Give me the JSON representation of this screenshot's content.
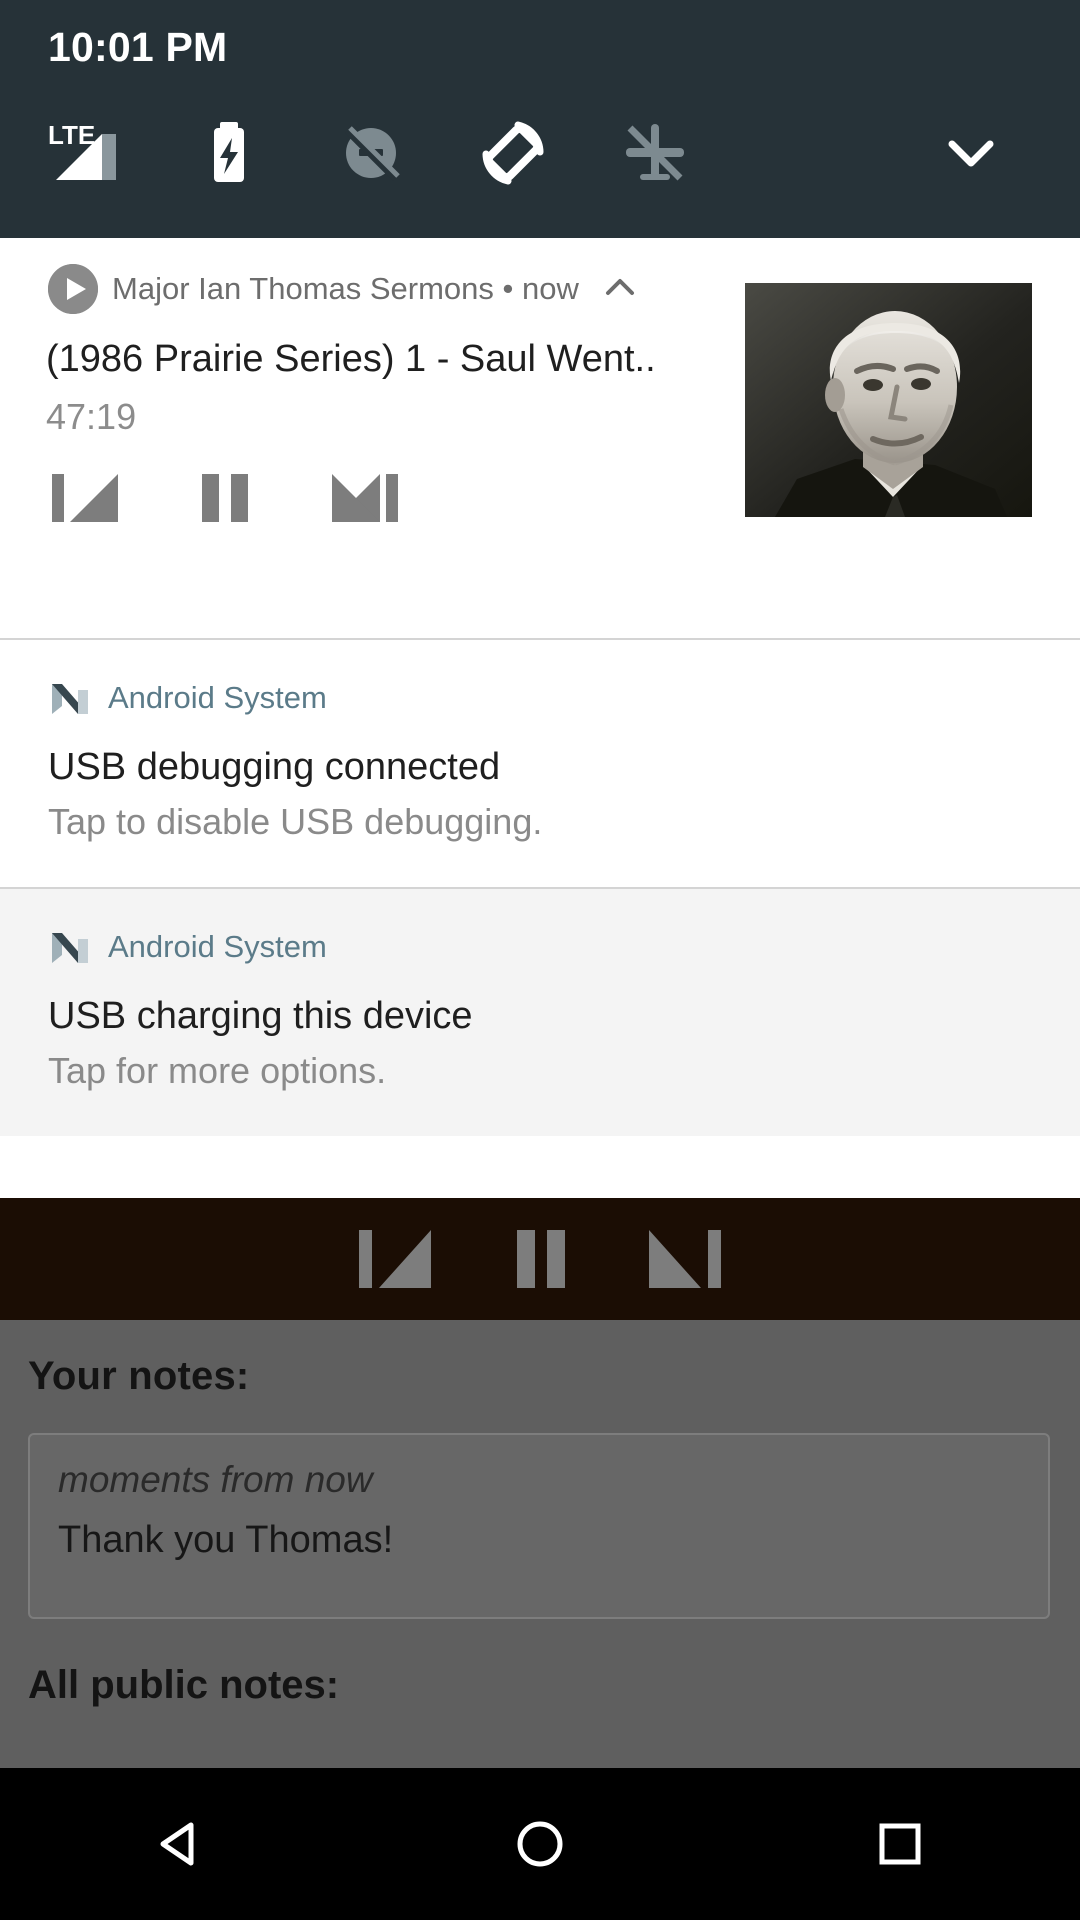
{
  "status_bar": {
    "time": "10:01 PM",
    "icons": [
      {
        "name": "lte-signal-icon",
        "label": "LTE"
      },
      {
        "name": "battery-charging-icon",
        "label": "Battery charging"
      },
      {
        "name": "do-not-disturb-off-icon",
        "label": "Do not disturb off"
      },
      {
        "name": "auto-rotate-icon",
        "label": "Auto-rotate"
      },
      {
        "name": "airplane-mode-off-icon",
        "label": "Airplane mode off"
      },
      {
        "name": "chevron-down-icon",
        "label": "Expand quick settings"
      }
    ]
  },
  "notifications": [
    {
      "id": "media",
      "app_name": "Major Ian Thomas Sermons",
      "time": "now",
      "header_line": "Major Ian Thomas Sermons • now",
      "title": "(1986 Prairie Series) 1 - Saul Went..",
      "subtitle": "47:19",
      "controls": [
        {
          "name": "previous-button",
          "label": "Previous"
        },
        {
          "name": "pause-button",
          "label": "Pause"
        },
        {
          "name": "next-button",
          "label": "Next"
        }
      ],
      "album_art_alt": "Portrait photograph"
    },
    {
      "id": "usb-debugging",
      "app_name": "Android System",
      "title": "USB debugging connected",
      "body": "Tap to disable USB debugging."
    },
    {
      "id": "usb-charging",
      "app_name": "Android System",
      "title": "USB charging this device",
      "body": "Tap for more options."
    }
  ],
  "media_bar": {
    "controls": [
      {
        "name": "previous-button",
        "label": "Previous"
      },
      {
        "name": "pause-button",
        "label": "Pause"
      },
      {
        "name": "next-button",
        "label": "Next"
      }
    ]
  },
  "app_content": {
    "your_notes_heading": "Your notes:",
    "note": {
      "time": "moments from now",
      "text": "Thank you Thomas!"
    },
    "all_public_notes_heading": "All public notes:"
  },
  "nav_bar": {
    "buttons": [
      {
        "name": "back-button",
        "label": "Back"
      },
      {
        "name": "home-button",
        "label": "Home"
      },
      {
        "name": "recents-button",
        "label": "Recents"
      }
    ]
  },
  "colors": {
    "status_bar_bg": "#263238",
    "shade_bg": "#ffffff",
    "alt_notif_bg": "#f4f4f4",
    "media_bar_bg": "#1b0d04",
    "app_dim_bg": "#5f5f5f",
    "nav_bar_bg": "#000000",
    "app_name_accent": "#5b7b89",
    "control_icon": "#7d7d7d"
  }
}
